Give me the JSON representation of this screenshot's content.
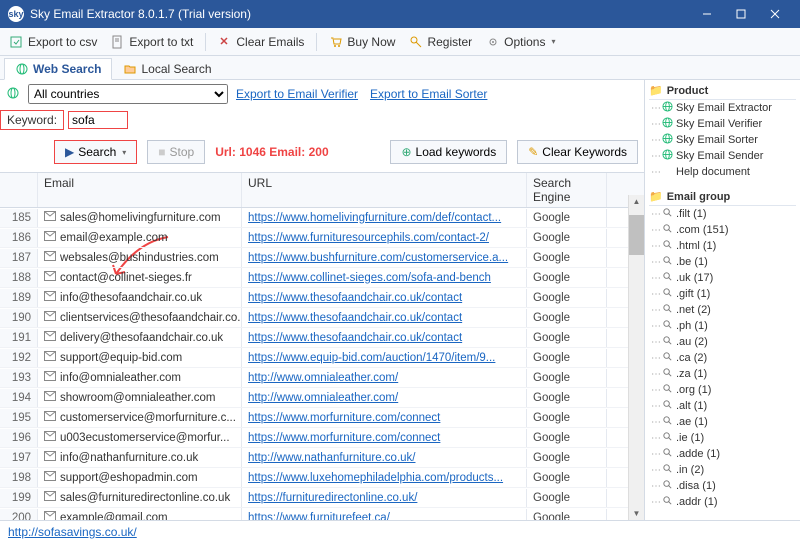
{
  "title": "Sky Email Extractor 8.0.1.7 (Trial version)",
  "toolbar": {
    "export_csv": "Export to csv",
    "export_txt": "Export to txt",
    "clear_emails": "Clear Emails",
    "buy_now": "Buy Now",
    "register": "Register",
    "options": "Options"
  },
  "tabs": {
    "web": "Web Search",
    "local": "Local Search"
  },
  "filter": {
    "country": "All countries",
    "export_verifier": "Export to Email Verifier",
    "export_sorter": "Export to Email Sorter"
  },
  "keyword_label": "Keyword:",
  "keyword_value": "sofa",
  "actions": {
    "search": "Search",
    "stop": "Stop",
    "load": "Load keywords",
    "clear": "Clear Keywords"
  },
  "stats": "Url: 1046 Email: 200",
  "columns": {
    "email": "Email",
    "url": "URL",
    "engine": "Search Engine"
  },
  "rows": [
    {
      "n": 185,
      "email": "sales@homelivingfurniture.com",
      "url": "https://www.homelivingfurniture.com/def/contact...",
      "eng": "Google"
    },
    {
      "n": 186,
      "email": "email@example.com",
      "url": "https://www.furnituresourcephils.com/contact-2/",
      "eng": "Google"
    },
    {
      "n": 187,
      "email": "websales@bushindustries.com",
      "url": "https://www.bushfurniture.com/customerservice.a...",
      "eng": "Google"
    },
    {
      "n": 188,
      "email": "contact@collinet-sieges.fr",
      "url": "https://www.collinet-sieges.com/sofa-and-bench",
      "eng": "Google"
    },
    {
      "n": 189,
      "email": "info@thesofaandchair.co.uk",
      "url": "https://www.thesofaandchair.co.uk/contact",
      "eng": "Google"
    },
    {
      "n": 190,
      "email": "clientservices@thesofaandchair.co.uk",
      "url": "https://www.thesofaandchair.co.uk/contact",
      "eng": "Google"
    },
    {
      "n": 191,
      "email": "delivery@thesofaandchair.co.uk",
      "url": "https://www.thesofaandchair.co.uk/contact",
      "eng": "Google"
    },
    {
      "n": 192,
      "email": "support@equip-bid.com",
      "url": "https://www.equip-bid.com/auction/1470/item/9...",
      "eng": "Google"
    },
    {
      "n": 193,
      "email": "info@omnialeather.com",
      "url": "http://www.omnialeather.com/",
      "eng": "Google"
    },
    {
      "n": 194,
      "email": "showroom@omnialeather.com",
      "url": "http://www.omnialeather.com/",
      "eng": "Google"
    },
    {
      "n": 195,
      "email": "customerservice@morfurniture.c...",
      "url": "https://www.morfurniture.com/connect",
      "eng": "Google"
    },
    {
      "n": 196,
      "email": "u003ecustomerservice@morfur...",
      "url": "https://www.morfurniture.com/connect",
      "eng": "Google"
    },
    {
      "n": 197,
      "email": "info@nathanfurniture.co.uk",
      "url": "http://www.nathanfurniture.co.uk/",
      "eng": "Google"
    },
    {
      "n": 198,
      "email": "support@eshopadmin.com",
      "url": "https://www.luxehomephiladelphia.com/products...",
      "eng": "Google"
    },
    {
      "n": 199,
      "email": "sales@furnituredirectonline.co.uk",
      "url": "https://furnituredirectonline.co.uk/",
      "eng": "Google"
    },
    {
      "n": 200,
      "email": "example@gmail.com",
      "url": "https://www.furniturefeet.ca/",
      "eng": "Google"
    }
  ],
  "statusbar": "http://sofasavings.co.uk/",
  "right": {
    "product_title": "Product",
    "products": [
      "Sky Email Extractor",
      "Sky Email Verifier",
      "Sky Email Sorter",
      "Sky Email Sender",
      "Help document"
    ],
    "group_title": "Email group",
    "groups": [
      ".filt (1)",
      ".com (151)",
      ".html (1)",
      ".be (1)",
      ".uk (17)",
      ".gift (1)",
      ".net (2)",
      ".ph (1)",
      ".au (2)",
      ".ca (2)",
      ".za (1)",
      ".org (1)",
      ".alt (1)",
      ".ae (1)",
      ".ie (1)",
      ".adde (1)",
      ".in (2)",
      ".disa (1)",
      ".addr (1)"
    ]
  }
}
